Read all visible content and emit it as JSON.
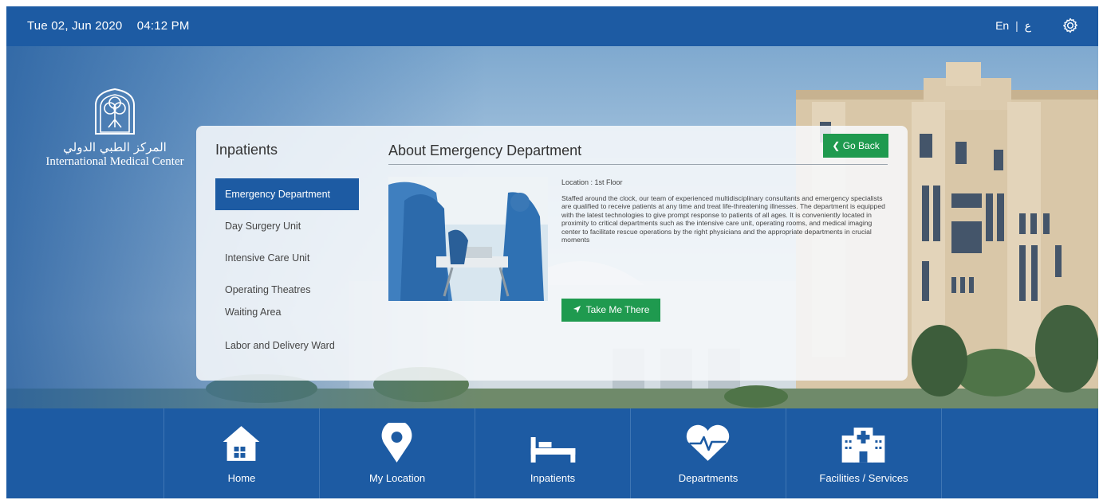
{
  "header": {
    "date": "Tue 02, Jun 2020",
    "time": "04:12 PM",
    "lang_en": "En",
    "lang_separator": "|",
    "lang_ar": "ع",
    "settings_icon": "gear-icon"
  },
  "logo": {
    "arabic_name": "المركز الطبي الدولي",
    "english_name": "International Medical Center"
  },
  "sidebar": {
    "title": "Inpatients",
    "items": [
      {
        "label": "Emergency Department"
      },
      {
        "label": "Day Surgery Unit"
      },
      {
        "label": "Intensive Care Unit"
      },
      {
        "label": "Operating Theatres"
      },
      {
        "label": "Waiting Area"
      },
      {
        "label": "Labor and Delivery Ward"
      }
    ],
    "active_index": 0
  },
  "content": {
    "title": "About Emergency Department",
    "go_back_label": "Go Back",
    "location": "Location : 1st Floor",
    "description": "Staffed around the clock, our team of experienced multidisciplinary consultants and emergency specialists are qualified to receive patients at any time and treat life-threatening illnesses. The department is equipped with the latest technologies to give prompt response to patients of all ages. It is conveniently located in proximity to critical departments such as the intensive care unit, operating rooms, and medical imaging center to facilitate rescue operations by the right physicians and the appropriate departments in crucial moments",
    "take_me_label": "Take Me There"
  },
  "nav": {
    "items": [
      {
        "label": "Home",
        "icon": "home-icon"
      },
      {
        "label": "My Location",
        "icon": "location-pin-icon"
      },
      {
        "label": "Inpatients",
        "icon": "bed-icon"
      },
      {
        "label": "Departments",
        "icon": "heart-pulse-icon"
      },
      {
        "label": "Facilities / Services",
        "icon": "hospital-icon"
      }
    ]
  },
  "colors": {
    "primary_blue": "#1d5ba3",
    "action_green": "#1f9a4f"
  }
}
